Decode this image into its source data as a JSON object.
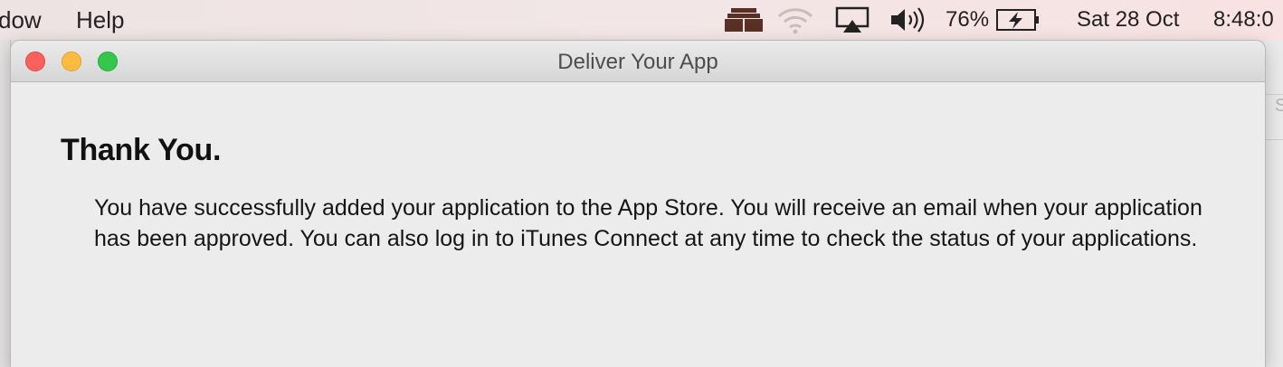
{
  "menubar": {
    "menus": [
      {
        "label": "dow"
      },
      {
        "label": "Help"
      }
    ],
    "status": {
      "icons": [
        "menu-extra-icon",
        "wifi-icon",
        "airplay-icon",
        "volume-icon",
        "battery-charging-icon"
      ],
      "battery_percent": "76%",
      "date": "Sat 28 Oct",
      "time": "8:48:0"
    }
  },
  "window": {
    "title": "Deliver Your App",
    "heading": "Thank You.",
    "message": "You have successfully added your application to the App Store. You will receive an email when your application has been approved. You can also log in to iTunes Connect at any time to check the status of your applications."
  },
  "background_window": {
    "fragment": "S"
  },
  "colors": {
    "close": "#fc605c",
    "minimize": "#fdbc40",
    "zoom": "#34c84a",
    "window_bg": "#ececec"
  }
}
